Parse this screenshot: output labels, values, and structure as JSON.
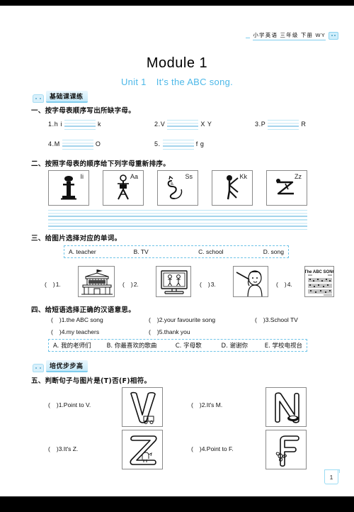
{
  "header": {
    "running_head": "小学英语 三年级 下册 WY",
    "icon": "face-icon"
  },
  "title": {
    "module": "Module 1",
    "unit_no": "Unit 1",
    "unit_name": "It's the ABC song."
  },
  "page_number": "1",
  "sections": [
    {
      "badge": "基础课课练",
      "badge_icon": "face-icon"
    },
    {
      "badge": "培优步步高",
      "badge_icon": "face-icon"
    }
  ],
  "ex1": {
    "heading": "一、按字母表顺序写出所缺字母。",
    "items": [
      {
        "num": "1.",
        "pre": "h i",
        "post": "k"
      },
      {
        "num": "2.",
        "pre": "V",
        "post": "X Y"
      },
      {
        "num": "3.",
        "pre": "P",
        "post": "R"
      },
      {
        "num": "4.",
        "pre": "M",
        "post": "O"
      },
      {
        "num": "5.",
        "pre": "",
        "post": "f g"
      }
    ]
  },
  "ex2": {
    "heading": "二、按照字母表的顺序给下列字母重新排序。",
    "boxes": [
      {
        "letter": "Ii",
        "figure": "person-standing-i"
      },
      {
        "letter": "Aa",
        "figure": "person-legs-apart-a"
      },
      {
        "letter": "Ss",
        "figure": "cat-curled-s"
      },
      {
        "letter": "Kk",
        "figure": "person-kicking-k"
      },
      {
        "letter": "Zz",
        "figure": "person-lying-z"
      }
    ]
  },
  "ex3": {
    "heading": "三、给图片选择对应的单词。",
    "options": [
      "A. teacher",
      "B. TV",
      "C. school",
      "D. song"
    ],
    "items": [
      {
        "paren": "(",
        "close": ")",
        "num": "1.",
        "picture": "school-building"
      },
      {
        "paren": "(",
        "close": ")",
        "num": "2.",
        "picture": "television"
      },
      {
        "paren": "(",
        "close": ")",
        "num": "3.",
        "picture": "teacher-pointing"
      },
      {
        "paren": "(",
        "close": ")",
        "num": "4.",
        "picture": "abc-song-sheet"
      }
    ],
    "picture_caption": "The ABC SONG"
  },
  "ex4": {
    "heading": "四、给短语选择正确的汉语意思。",
    "items": [
      {
        "num": "1.",
        "text": "the ABC song"
      },
      {
        "num": "2.",
        "text": "your favourite song"
      },
      {
        "num": "3.",
        "text": "School TV"
      },
      {
        "num": "4.",
        "text": "my teachers"
      },
      {
        "num": "5.",
        "text": "thank you"
      }
    ],
    "options": [
      "A. 我的老师们",
      "B. 你最喜欢的歌曲",
      "C. 字母歌",
      "D. 谢谢你",
      "E. 学校电视台"
    ]
  },
  "ex5": {
    "heading": "五、判断句子与图片是(T)否(F)相符。",
    "items": [
      {
        "num": "1.",
        "text": "Point to V.",
        "letter": "V",
        "picture": "letter-v-van"
      },
      {
        "num": "2.",
        "text": "It's M.",
        "letter": "N",
        "picture": "letter-n-nest"
      },
      {
        "num": "3.",
        "text": "It's Z.",
        "letter": "Z",
        "picture": "letter-z-zebra"
      },
      {
        "num": "4.",
        "text": "Point to F.",
        "letter": "F",
        "picture": "letter-f-fan"
      }
    ]
  },
  "colors": {
    "accent_blue": "#4db8e8",
    "rule_blue": "#7fcdee",
    "line_light": "#bfe6f5",
    "line_mid": "#4aa8d8"
  }
}
